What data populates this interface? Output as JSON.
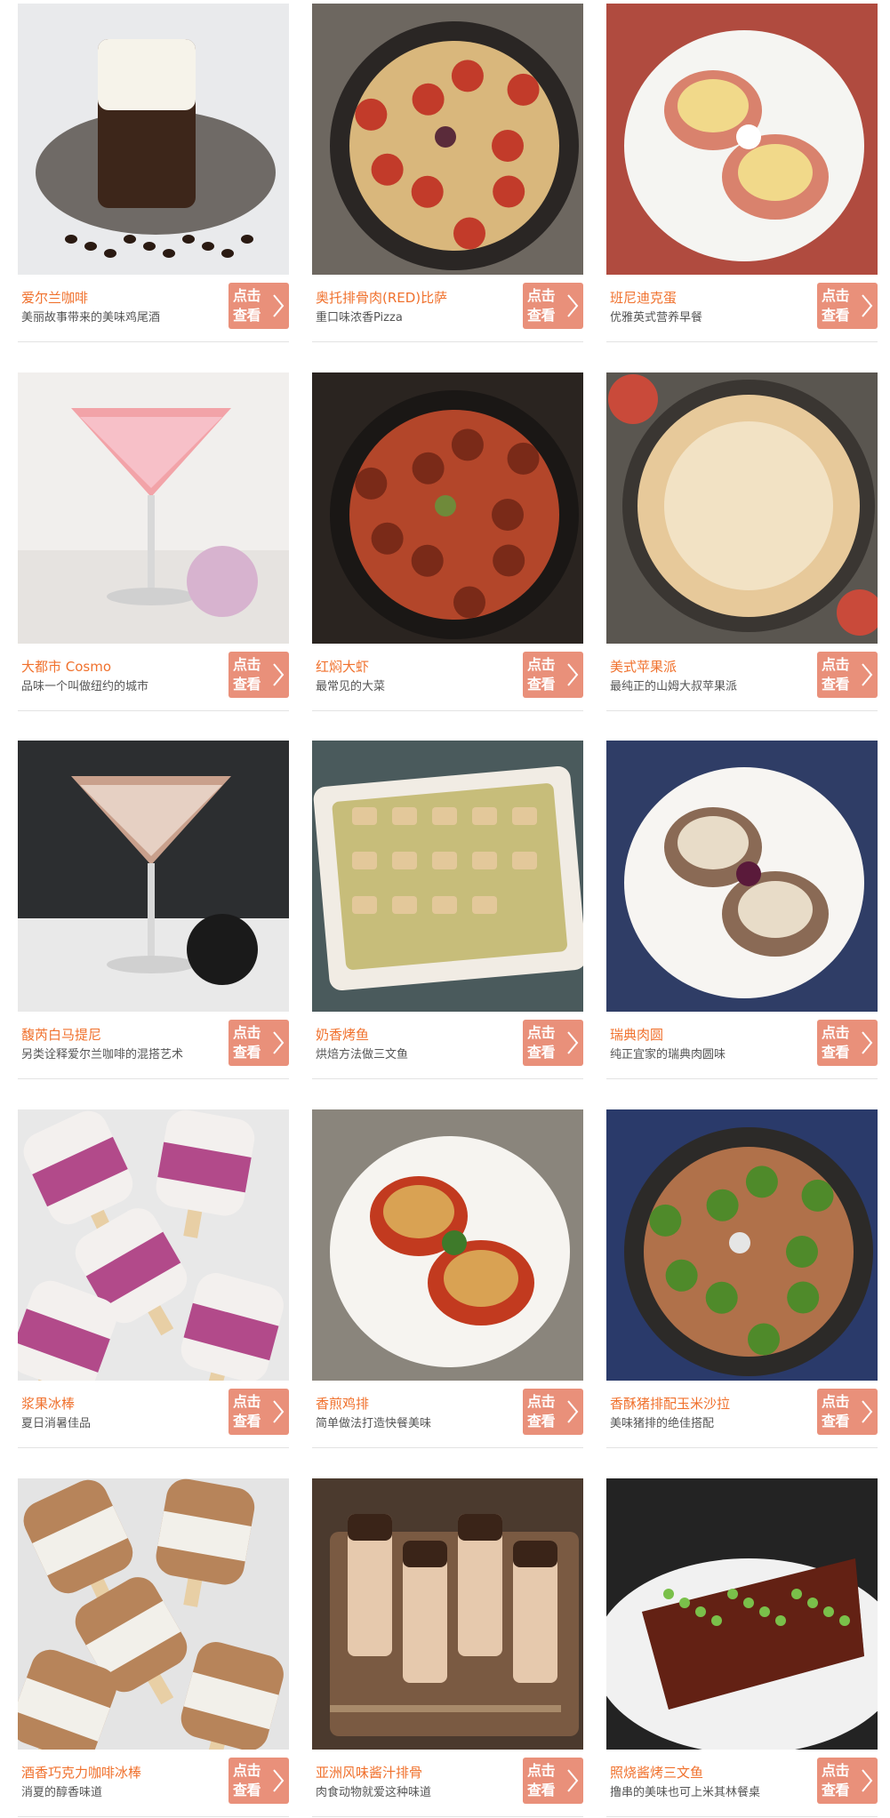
{
  "button_label": "点击查看",
  "items": [
    {
      "title": "爱尔兰咖啡",
      "desc": "美丽故事带来的美味鸡尾酒",
      "photo": "irish-coffee-photo"
    },
    {
      "title": "奥托排骨肉(RED)比萨",
      "desc": "重口味浓香Pizza",
      "photo": "pizza-photo"
    },
    {
      "title": "班尼迪克蛋",
      "desc": "优雅英式营养早餐",
      "photo": "eggs-benedict-photo"
    },
    {
      "title": "大都市 Cosmo",
      "desc": "品味一个叫做纽约的城市",
      "photo": "cosmo-cocktail-photo"
    },
    {
      "title": "红焖大虾",
      "desc": "最常见的大菜",
      "photo": "braised-shrimp-photo"
    },
    {
      "title": "美式苹果派",
      "desc": "最纯正的山姆大叔苹果派",
      "photo": "apple-pie-photo"
    },
    {
      "title": "馥芮白马提尼",
      "desc": "另类诠释爱尔兰咖啡的混搭艺术",
      "photo": "martini-photo"
    },
    {
      "title": "奶香烤鱼",
      "desc": "烘焙方法做三文鱼",
      "photo": "baked-fish-photo"
    },
    {
      "title": "瑞典肉圆",
      "desc": "纯正宜家的瑞典肉圆味",
      "photo": "swedish-meatballs-photo"
    },
    {
      "title": "浆果冰棒",
      "desc": "夏日消暑佳品",
      "photo": "berry-popsicle-photo"
    },
    {
      "title": "香煎鸡排",
      "desc": "简单做法打造快餐美味",
      "photo": "chicken-cutlet-photo"
    },
    {
      "title": "香酥猪排配玉米沙拉",
      "desc": "美味猪排的绝佳搭配",
      "photo": "pork-chop-salad-photo"
    },
    {
      "title": "酒香巧克力咖啡冰棒",
      "desc": "消夏的醇香味道",
      "photo": "mocha-popsicle-photo"
    },
    {
      "title": "亚洲风味酱汁排骨",
      "desc": "肉食动物就爱这种味道",
      "photo": "asian-ribs-photo"
    },
    {
      "title": "照烧酱烤三文鱼",
      "desc": "撸串的美味也可上米其林餐桌",
      "photo": "teriyaki-salmon-photo"
    }
  ]
}
